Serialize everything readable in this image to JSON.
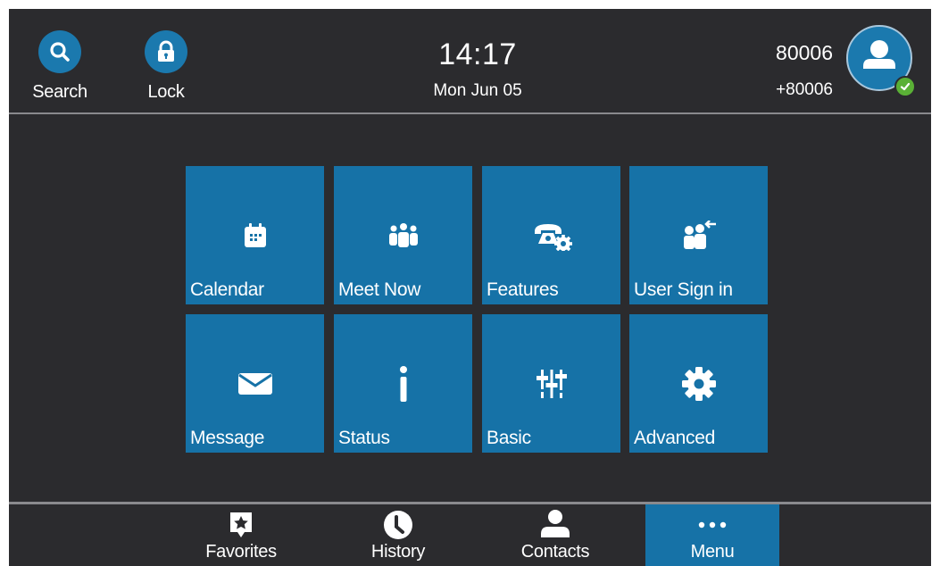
{
  "header": {
    "search_label": "Search",
    "lock_label": "Lock",
    "time": "14:17",
    "date": "Mon Jun 05",
    "account_number": "80006",
    "account_extension": "+80006"
  },
  "tiles": [
    {
      "label": "Calendar",
      "icon": "calendar-icon"
    },
    {
      "label": "Meet Now",
      "icon": "meeting-people-icon"
    },
    {
      "label": "Features",
      "icon": "phone-gear-icon"
    },
    {
      "label": "User Sign in",
      "icon": "user-sign-in-icon"
    },
    {
      "label": "Message",
      "icon": "envelope-icon"
    },
    {
      "label": "Status",
      "icon": "info-icon"
    },
    {
      "label": "Basic",
      "icon": "sliders-icon"
    },
    {
      "label": "Advanced",
      "icon": "gear-icon"
    }
  ],
  "nav": [
    {
      "label": "Favorites",
      "icon": "favorites-star-icon"
    },
    {
      "label": "History",
      "icon": "clock-icon"
    },
    {
      "label": "Contacts",
      "icon": "contact-person-icon"
    },
    {
      "label": "Menu",
      "icon": "more-dots-icon",
      "active": true
    }
  ],
  "colors": {
    "background": "#2b2b2e",
    "accent": "#1672a7",
    "presence_available": "#5ab036"
  }
}
